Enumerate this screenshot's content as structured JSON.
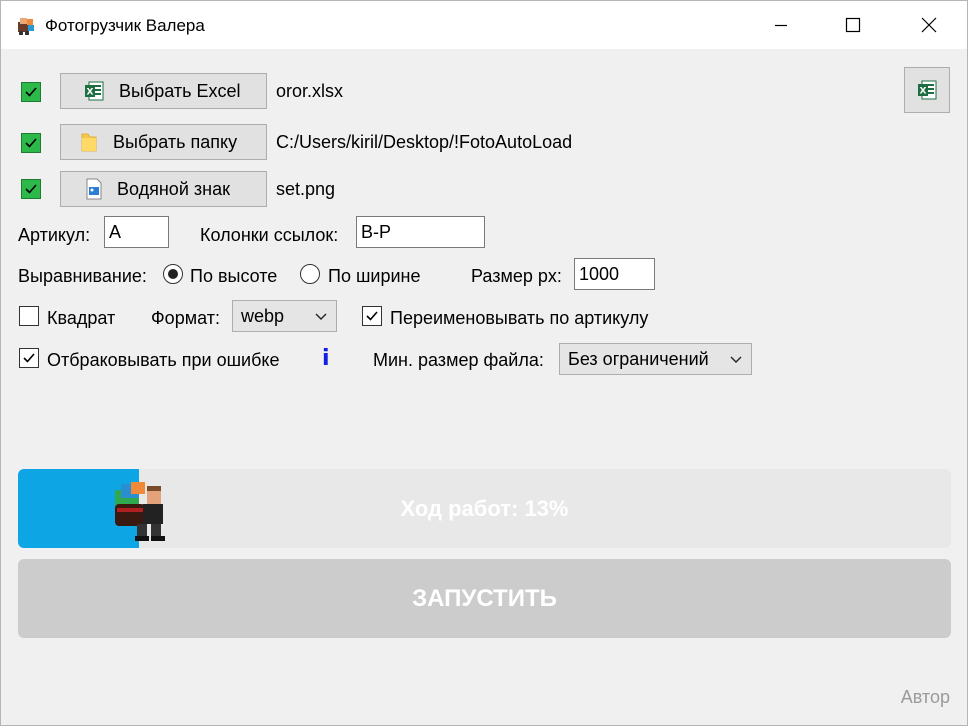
{
  "window": {
    "title": "Фотогрузчик Валера"
  },
  "files": {
    "excel": {
      "button_label": "Выбрать Excel",
      "value": "oror.xlsx",
      "checked": true
    },
    "folder": {
      "button_label": "Выбрать папку",
      "value": "C:/Users/kiril/Desktop/!FotoAutoLoad",
      "checked": true
    },
    "watermark": {
      "button_label": "Водяной знак",
      "value": "set.png",
      "checked": true
    }
  },
  "fields": {
    "article_label": "Артикул:",
    "article_value": "A",
    "link_columns_label": "Колонки ссылок:",
    "link_columns_value": "B-P"
  },
  "alignment": {
    "label": "Выравнивание:",
    "by_height": "По высоте",
    "by_width": "По ширине",
    "selected": "По высоте",
    "size_label": "Размер px:",
    "size_value": "1000"
  },
  "options": {
    "square_label": "Квадрат",
    "square_checked": false,
    "format_label": "Формат:",
    "format_value": "webp",
    "rename_label": "Переименовывать по артикулу",
    "rename_checked": true,
    "reject_label": "Отбраковывать при ошибке",
    "reject_checked": true,
    "min_size_label": "Мин. размер файла:",
    "min_size_value": "Без ограничений"
  },
  "progress": {
    "text": "Ход работ: 13%",
    "value": 0.13
  },
  "run_button": "ЗАПУСТИТЬ",
  "author_link": "Автор",
  "icons": {
    "excel": "excel-icon",
    "folder": "folder-icon",
    "image": "image-file-icon",
    "info": "i"
  },
  "colors": {
    "checkbox_green": "#2db84a",
    "progress_fill": "#0ea5e5",
    "info_blue": "#1020e0"
  }
}
